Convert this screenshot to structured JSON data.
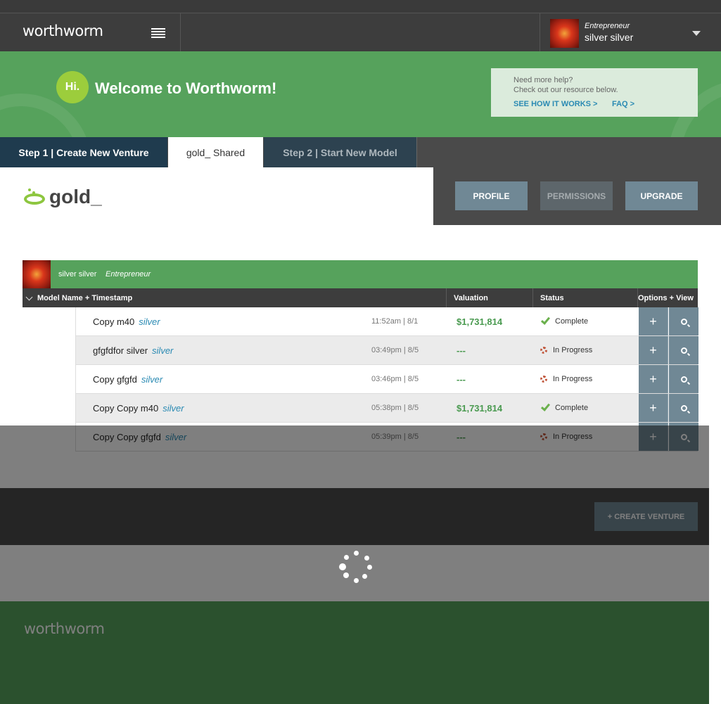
{
  "header": {
    "logo": "worthworm",
    "menu_icon": "list-icon",
    "user_role": "Entrepreneur",
    "user_name": "silver silver"
  },
  "banner": {
    "hi": "Hi.",
    "welcome": "Welcome to Worthworm!",
    "help_line1": "Need more help?",
    "help_line2": "Check out our resource below.",
    "help_link1": "SEE HOW IT WORKS >",
    "help_link2": "FAQ >"
  },
  "tabs": [
    {
      "label": "Step 1 | Create New Venture"
    },
    {
      "label": "gold_ Shared"
    },
    {
      "label": "Step 2 | Start New Model"
    }
  ],
  "venture": {
    "title": "gold_",
    "actions": {
      "profile": "PROFILE",
      "permissions": "PERMISSIONS",
      "upgrade": "UPGRADE"
    }
  },
  "owner": {
    "name": "silver silver",
    "role": "Entrepreneur"
  },
  "table": {
    "headers": {
      "model": "Model Name + Timestamp",
      "valuation": "Valuation",
      "status": "Status",
      "options": "Options + View"
    },
    "rows": [
      {
        "name": "Copy m40",
        "owner": "silver",
        "time": "11:52am | 8/1",
        "valuation": "$1,731,814",
        "status": "Complete"
      },
      {
        "name": "gfgfdfor silver",
        "owner": "silver",
        "time": "03:49pm | 8/5",
        "valuation": "---",
        "status": "In Progress"
      },
      {
        "name": "Copy gfgfd",
        "owner": "silver",
        "time": "03:46pm | 8/5",
        "valuation": "---",
        "status": "In Progress"
      },
      {
        "name": "Copy Copy m40",
        "owner": "silver",
        "time": "05:38pm | 8/5",
        "valuation": "$1,731,814",
        "status": "Complete"
      },
      {
        "name": "Copy Copy gfgfd",
        "owner": "silver",
        "time": "05:39pm | 8/5",
        "valuation": "---",
        "status": "In Progress"
      }
    ]
  },
  "cta": {
    "create_venture": "+ CREATE VENTURE"
  },
  "footer": {
    "logo": "worthworm"
  },
  "colors": {
    "brand_green": "#56a25c",
    "accent_lime": "#9ccd3c",
    "button_slate": "#708895",
    "navy": "#1f3b4e",
    "link_blue": "#2a8ab3"
  }
}
